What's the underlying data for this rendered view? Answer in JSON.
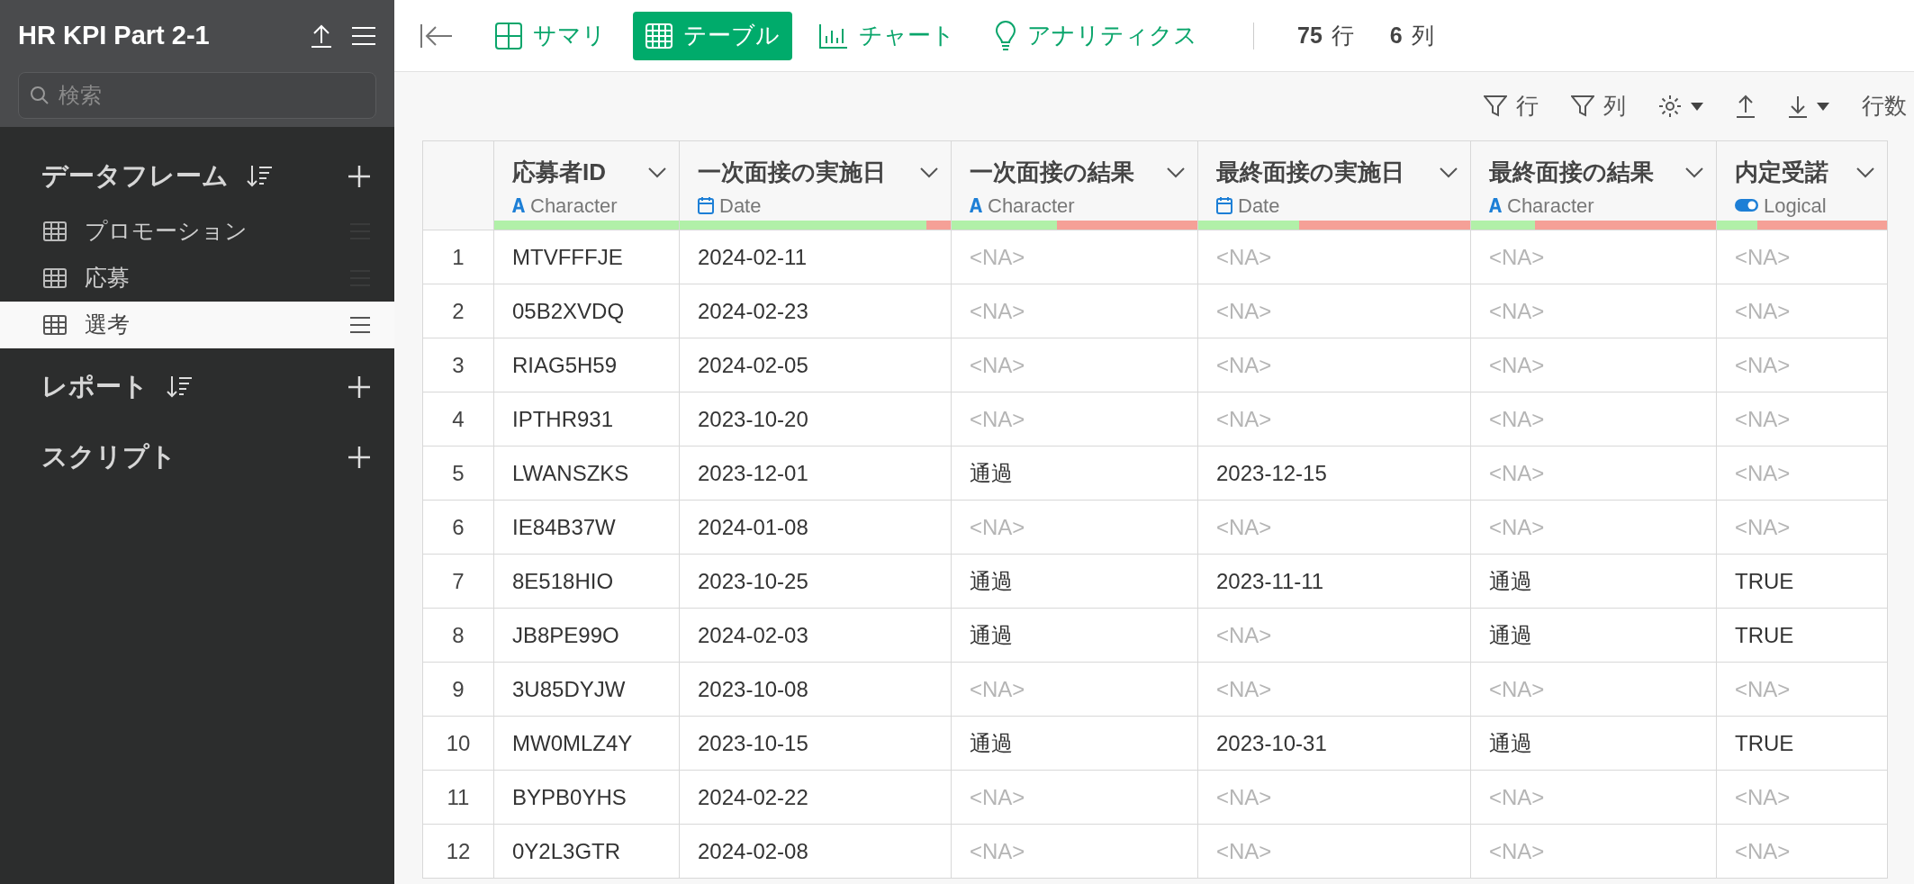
{
  "sidebar": {
    "title": "HR KPI Part 2-1",
    "search": {
      "placeholder": "検索"
    },
    "sections": [
      {
        "label": "データフレーム",
        "sortable": true,
        "items": [
          {
            "label": "プロモーション",
            "selected": false
          },
          {
            "label": "応募",
            "selected": false
          },
          {
            "label": "選考",
            "selected": true
          }
        ]
      },
      {
        "label": "レポート",
        "sortable": true
      },
      {
        "label": "スクリプト",
        "sortable": false
      }
    ]
  },
  "toolbar": {
    "tabs": [
      {
        "kind": "summary",
        "label": "サマリ",
        "selected": false
      },
      {
        "kind": "table",
        "label": "テーブル",
        "selected": true
      },
      {
        "kind": "chart",
        "label": "チャート",
        "selected": false
      },
      {
        "kind": "analytics",
        "label": "アナリティクス",
        "selected": false
      }
    ],
    "counts": [
      {
        "value": "75",
        "unit": "行"
      },
      {
        "value": "6",
        "unit": "列"
      }
    ]
  },
  "actions": [
    {
      "kind": "filter",
      "label": "行",
      "caret": false
    },
    {
      "kind": "filter",
      "label": "列",
      "caret": false
    },
    {
      "kind": "gear",
      "caret": true
    },
    {
      "kind": "upload",
      "caret": false
    },
    {
      "kind": "download",
      "caret": true
    },
    {
      "kind": "text",
      "label": "行数",
      "caret": false
    }
  ],
  "table": {
    "columns": [
      {
        "name": "応募者ID",
        "kind": "character",
        "type_label": "Character",
        "level": 1
      },
      {
        "name": "一次面接の実施日",
        "kind": "date",
        "type_label": "Date",
        "level": 0.91
      },
      {
        "name": "一次面接の結果",
        "kind": "character",
        "type_label": "Character",
        "level": 0.43
      },
      {
        "name": "最終面接の実施日",
        "kind": "date",
        "type_label": "Date",
        "level": 0.37
      },
      {
        "name": "最終面接の結果",
        "kind": "character",
        "type_label": "Character",
        "level": 0.26
      },
      {
        "name": "内定受諾",
        "kind": "logical",
        "type_label": "Logical",
        "level": 0.24
      }
    ],
    "rows": [
      {
        "index": "1",
        "cells": [
          {
            "text": "MTVFFFJE",
            "missing": false
          },
          {
            "text": "2024-02-11",
            "missing": false
          },
          {
            "text": "<NA>",
            "missing": true
          },
          {
            "text": "<NA>",
            "missing": true
          },
          {
            "text": "<NA>",
            "missing": true
          },
          {
            "text": "<NA>",
            "missing": true
          }
        ]
      },
      {
        "index": "2",
        "cells": [
          {
            "text": "05B2XVDQ",
            "missing": false
          },
          {
            "text": "2024-02-23",
            "missing": false
          },
          {
            "text": "<NA>",
            "missing": true
          },
          {
            "text": "<NA>",
            "missing": true
          },
          {
            "text": "<NA>",
            "missing": true
          },
          {
            "text": "<NA>",
            "missing": true
          }
        ]
      },
      {
        "index": "3",
        "cells": [
          {
            "text": "RIAG5H59",
            "missing": false
          },
          {
            "text": "2024-02-05",
            "missing": false
          },
          {
            "text": "<NA>",
            "missing": true
          },
          {
            "text": "<NA>",
            "missing": true
          },
          {
            "text": "<NA>",
            "missing": true
          },
          {
            "text": "<NA>",
            "missing": true
          }
        ]
      },
      {
        "index": "4",
        "cells": [
          {
            "text": "IPTHR931",
            "missing": false
          },
          {
            "text": "2023-10-20",
            "missing": false
          },
          {
            "text": "<NA>",
            "missing": true
          },
          {
            "text": "<NA>",
            "missing": true
          },
          {
            "text": "<NA>",
            "missing": true
          },
          {
            "text": "<NA>",
            "missing": true
          }
        ]
      },
      {
        "index": "5",
        "cells": [
          {
            "text": "LWANSZKS",
            "missing": false
          },
          {
            "text": "2023-12-01",
            "missing": false
          },
          {
            "text": "通過",
            "missing": false
          },
          {
            "text": "2023-12-15",
            "missing": false
          },
          {
            "text": "<NA>",
            "missing": true
          },
          {
            "text": "<NA>",
            "missing": true
          }
        ]
      },
      {
        "index": "6",
        "cells": [
          {
            "text": "IE84B37W",
            "missing": false
          },
          {
            "text": "2024-01-08",
            "missing": false
          },
          {
            "text": "<NA>",
            "missing": true
          },
          {
            "text": "<NA>",
            "missing": true
          },
          {
            "text": "<NA>",
            "missing": true
          },
          {
            "text": "<NA>",
            "missing": true
          }
        ]
      },
      {
        "index": "7",
        "cells": [
          {
            "text": "8E518HIO",
            "missing": false
          },
          {
            "text": "2023-10-25",
            "missing": false
          },
          {
            "text": "通過",
            "missing": false
          },
          {
            "text": "2023-11-11",
            "missing": false
          },
          {
            "text": "通過",
            "missing": false
          },
          {
            "text": "TRUE",
            "missing": false
          }
        ]
      },
      {
        "index": "8",
        "cells": [
          {
            "text": "JB8PE99O",
            "missing": false
          },
          {
            "text": "2024-02-03",
            "missing": false
          },
          {
            "text": "通過",
            "missing": false
          },
          {
            "text": "<NA>",
            "missing": true
          },
          {
            "text": "通過",
            "missing": false
          },
          {
            "text": "TRUE",
            "missing": false
          }
        ]
      },
      {
        "index": "9",
        "cells": [
          {
            "text": "3U85DYJW",
            "missing": false
          },
          {
            "text": "2023-10-08",
            "missing": false
          },
          {
            "text": "<NA>",
            "missing": true
          },
          {
            "text": "<NA>",
            "missing": true
          },
          {
            "text": "<NA>",
            "missing": true
          },
          {
            "text": "<NA>",
            "missing": true
          }
        ]
      },
      {
        "index": "10",
        "cells": [
          {
            "text": "MW0MLZ4Y",
            "missing": false
          },
          {
            "text": "2023-10-15",
            "missing": false
          },
          {
            "text": "通過",
            "missing": false
          },
          {
            "text": "2023-10-31",
            "missing": false
          },
          {
            "text": "通過",
            "missing": false
          },
          {
            "text": "TRUE",
            "missing": false
          }
        ]
      },
      {
        "index": "11",
        "cells": [
          {
            "text": "BYPB0YHS",
            "missing": false
          },
          {
            "text": "2024-02-22",
            "missing": false
          },
          {
            "text": "<NA>",
            "missing": true
          },
          {
            "text": "<NA>",
            "missing": true
          },
          {
            "text": "<NA>",
            "missing": true
          },
          {
            "text": "<NA>",
            "missing": true
          }
        ]
      },
      {
        "index": "12",
        "cells": [
          {
            "text": "0Y2L3GTR",
            "missing": false
          },
          {
            "text": "2024-02-08",
            "missing": false
          },
          {
            "text": "<NA>",
            "missing": true
          },
          {
            "text": "<NA>",
            "missing": true
          },
          {
            "text": "<NA>",
            "missing": true
          },
          {
            "text": "<NA>",
            "missing": true
          }
        ]
      }
    ]
  }
}
